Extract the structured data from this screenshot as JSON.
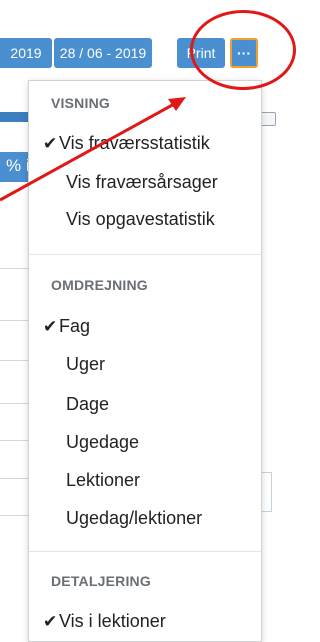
{
  "toolbar": {
    "date_start": "2019",
    "date_end": "28 / 06 - 2019",
    "print_label": "Print",
    "more_label": "···"
  },
  "background": {
    "partial_text": "% i"
  },
  "menu": {
    "section_visning": "VISNING",
    "vis_fravaersstatistik": "Vis fraværsstatistik",
    "vis_fravaersarsager": "Vis fraværsårsager",
    "vis_opgavestatistik": "Vis opgavestatistik",
    "section_omdrejning": "OMDREJNING",
    "fag": "Fag",
    "uger": "Uger",
    "dage": "Dage",
    "ugedage": "Ugedage",
    "lektioner": "Lektioner",
    "ugedag_lektioner": "Ugedag/lektioner",
    "section_detaljering": "DETALJERING",
    "vis_i_lektioner": "Vis i lektioner",
    "check_glyph": "✔"
  },
  "colors": {
    "accent": "#4a8fcf",
    "highlight_border": "#f0a030",
    "annotation": "#e01818"
  }
}
